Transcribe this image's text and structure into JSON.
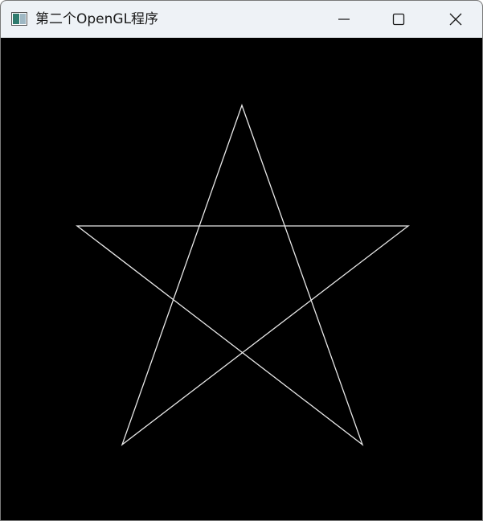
{
  "window": {
    "title": "第二个OpenGL程序",
    "icon": "app-window-icon",
    "controls": {
      "minimize_icon": "minimize-icon",
      "maximize_icon": "maximize-icon",
      "close_icon": "close-icon"
    }
  },
  "canvas": {
    "background": "#000000",
    "stroke_color": "#e8e8e8",
    "shape": "five-pointed star outline"
  }
}
